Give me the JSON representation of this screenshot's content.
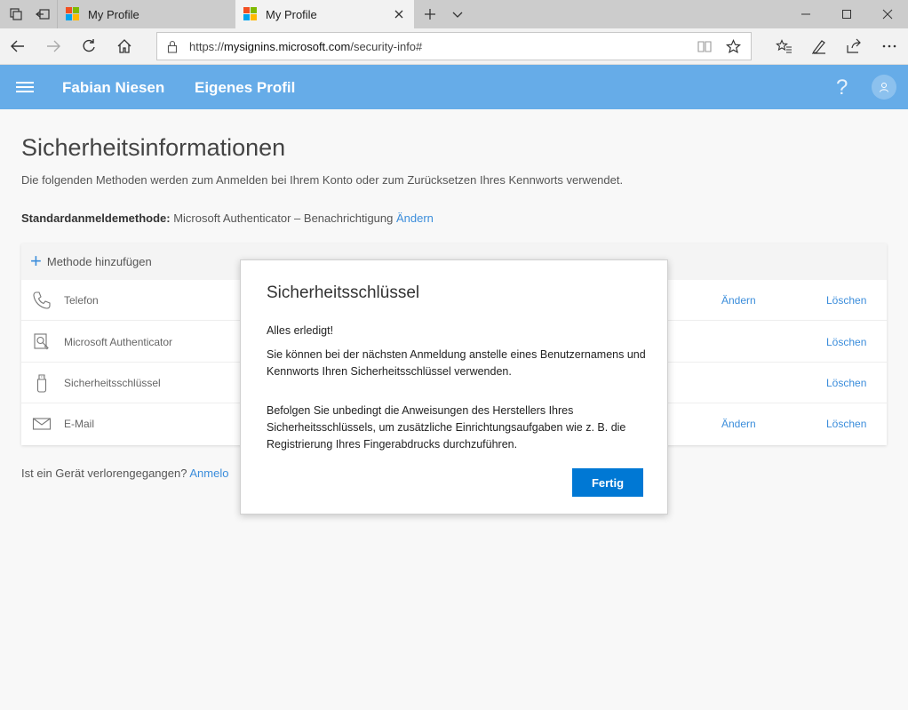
{
  "browser": {
    "tabs": [
      {
        "title": "My Profile"
      },
      {
        "title": "My Profile"
      }
    ],
    "url_prefix": "https://",
    "url_host": "mysignins.microsoft.com",
    "url_path": "/security-info#"
  },
  "header": {
    "user_name": "Fabian Niesen",
    "nav_profile": "Eigenes Profil",
    "help": "?"
  },
  "page": {
    "title": "Sicherheitsinformationen",
    "description": "Die folgenden Methoden werden zum Anmelden bei Ihrem Konto oder zum Zurücksetzen Ihres Kennworts verwendet.",
    "default_label": "Standardanmeldemethode:",
    "default_value": "Microsoft Authenticator – Benachrichtigung",
    "default_change": "Ändern",
    "add_method": "Methode hinzufügen",
    "methods": [
      {
        "label": "Telefon",
        "change": "Ändern",
        "delete": "Löschen"
      },
      {
        "label": "Microsoft Authenticator",
        "change": "",
        "delete": "Löschen"
      },
      {
        "label": "Sicherheitsschlüssel",
        "change": "",
        "delete": "Löschen"
      },
      {
        "label": "E-Mail",
        "change": "Ändern",
        "delete": "Löschen"
      }
    ],
    "lost_device": "Ist ein Gerät verlorengegangen?",
    "lost_device_link": "Anmelo"
  },
  "dialog": {
    "title": "Sicherheitsschlüssel",
    "line1": "Alles erledigt!",
    "line2": "Sie können bei der nächsten Anmeldung anstelle eines Benutzernamens und Kennworts Ihren Sicherheitsschlüssel verwenden.",
    "line3": "Befolgen Sie unbedingt die Anweisungen des Herstellers Ihres Sicherheitsschlüssels, um zusätzliche Einrichtungsaufgaben wie z. B. die Registrierung Ihres Fingerabdrucks durchzuführen.",
    "button": "Fertig"
  },
  "colors": {
    "header_bg": "#66ace8",
    "link": "#3b8ddb",
    "primary_button": "#0078d4"
  }
}
